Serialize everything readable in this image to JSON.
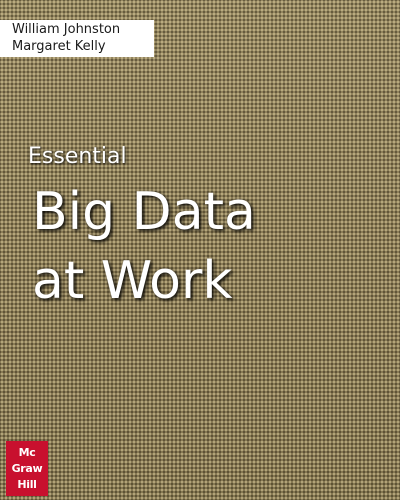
{
  "authors": [
    "William Johnston",
    "Margaret Kelly"
  ],
  "subtitle": "Essential",
  "title_lines": [
    "Big Data",
    "at Work"
  ],
  "publisher_logo": {
    "words": [
      "Mc",
      "Graw",
      "Hill"
    ],
    "color": "#c8102e"
  },
  "colors": {
    "cover_background": "#8e7f59",
    "title_text": "#ffffff",
    "author_box": "#ffffff"
  }
}
